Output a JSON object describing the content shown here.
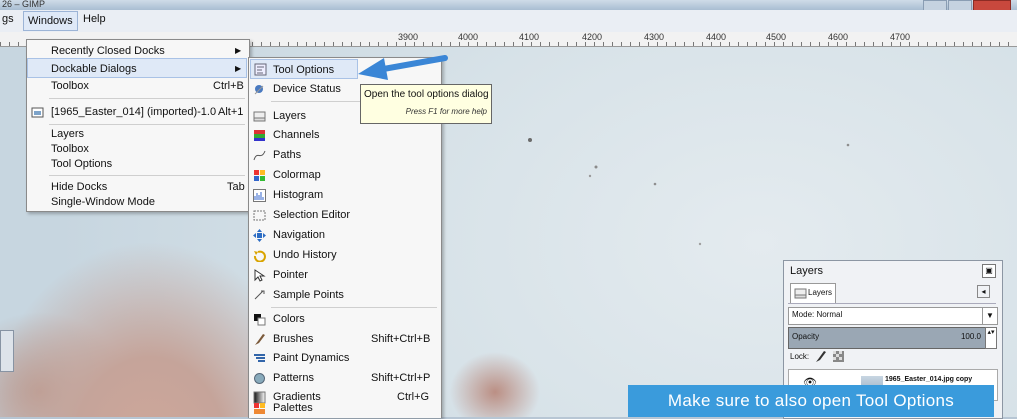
{
  "window": {
    "title": "26 – GIMP"
  },
  "menubar": {
    "items": [
      "gs",
      "Windows",
      "Help"
    ]
  },
  "ruler": {
    "ticks": [
      "3900",
      "4000",
      "4100",
      "4200",
      "4300",
      "4400",
      "4500",
      "4600",
      "4700"
    ]
  },
  "windows_menu": {
    "items": [
      {
        "label": "Recently Closed Docks",
        "shortcut": "",
        "submenu": true
      },
      {
        "label": "Dockable Dialogs",
        "shortcut": "",
        "submenu": true
      },
      {
        "label": "Toolbox",
        "shortcut": "Ctrl+B",
        "submenu": false
      },
      {
        "label": "[1965_Easter_014] (imported)-1.0",
        "shortcut": "Alt+1",
        "submenu": false
      },
      {
        "label": "Layers",
        "shortcut": "",
        "submenu": false
      },
      {
        "label": "Toolbox",
        "shortcut": "",
        "submenu": false
      },
      {
        "label": "Tool Options",
        "shortcut": "",
        "submenu": false
      },
      {
        "label": "Hide Docks",
        "shortcut": "Tab",
        "submenu": false
      },
      {
        "label": "Single-Window Mode",
        "shortcut": "",
        "submenu": false
      }
    ]
  },
  "dockable_menu": {
    "items": [
      {
        "label": "Tool Options",
        "shortcut": "",
        "icon": "tool-options-icon"
      },
      {
        "label": "Device Status",
        "shortcut": "",
        "icon": "device-status-icon"
      },
      {
        "label": "Layers",
        "shortcut": "",
        "icon": "layers-icon"
      },
      {
        "label": "Channels",
        "shortcut": "",
        "icon": "channels-icon"
      },
      {
        "label": "Paths",
        "shortcut": "",
        "icon": "paths-icon"
      },
      {
        "label": "Colormap",
        "shortcut": "",
        "icon": "colormap-icon"
      },
      {
        "label": "Histogram",
        "shortcut": "",
        "icon": "histogram-icon"
      },
      {
        "label": "Selection Editor",
        "shortcut": "",
        "icon": "selection-editor-icon"
      },
      {
        "label": "Navigation",
        "shortcut": "",
        "icon": "navigation-icon"
      },
      {
        "label": "Undo History",
        "shortcut": "",
        "icon": "undo-history-icon"
      },
      {
        "label": "Pointer",
        "shortcut": "",
        "icon": "pointer-icon"
      },
      {
        "label": "Sample Points",
        "shortcut": "",
        "icon": "sample-points-icon"
      },
      {
        "label": "Colors",
        "shortcut": "",
        "icon": "colors-icon"
      },
      {
        "label": "Brushes",
        "shortcut": "Shift+Ctrl+B",
        "icon": "brushes-icon"
      },
      {
        "label": "Paint Dynamics",
        "shortcut": "",
        "icon": "paint-dynamics-icon"
      },
      {
        "label": "Patterns",
        "shortcut": "Shift+Ctrl+P",
        "icon": "patterns-icon"
      },
      {
        "label": "Gradients",
        "shortcut": "Ctrl+G",
        "icon": "gradients-icon"
      },
      {
        "label": "Palettes",
        "shortcut": "",
        "icon": "palettes-icon"
      }
    ]
  },
  "tooltip": {
    "text": "Open the tool options dialog",
    "hint": "Press F1 for more help"
  },
  "layers_panel": {
    "title": "Layers",
    "tab": "Layers",
    "mode_label": "Mode: Normal",
    "opacity_label": "Opacity",
    "opacity_value": "100.0",
    "lock_label": "Lock:",
    "layer_name": "1965_Easter_014.jpg copy"
  },
  "caption": {
    "text": "Make sure to also open Tool Options"
  },
  "colors": {
    "accent_arrow": "#3a86d6",
    "caption_bg": "#3a9bdc",
    "highlight": "#dfe9f7"
  }
}
